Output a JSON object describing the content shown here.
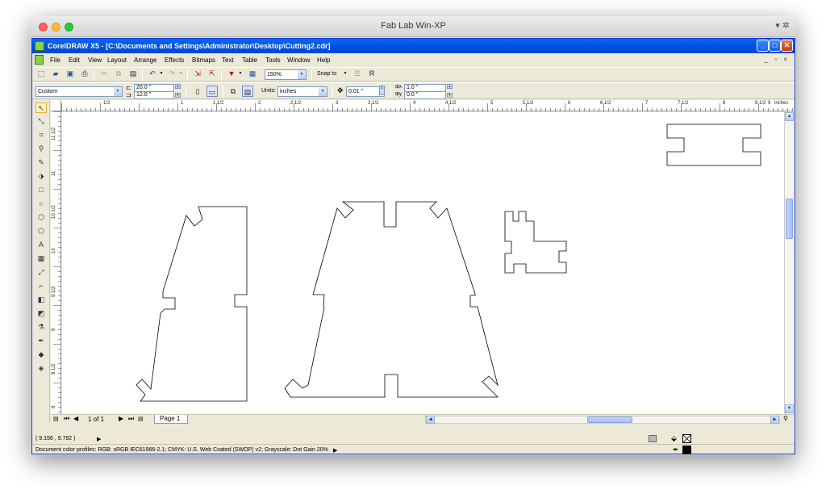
{
  "mac": {
    "title": "Fab Lab Win-XP",
    "title_icons": "▾ ✲"
  },
  "app": {
    "title": "CorelDRAW X5 - [C:\\Documents and Settings\\Administrator\\Desktop\\Cutting2.cdr]",
    "caption_buttons": [
      "_",
      "□",
      "✕"
    ],
    "doc_controls": "_ ▫ ×"
  },
  "menu": [
    "File",
    "Edit",
    "View",
    "Layout",
    "Arrange",
    "Effects",
    "Bitmaps",
    "Text",
    "Table",
    "Tools",
    "Window",
    "Help"
  ],
  "toolbar": {
    "zoom": "150%",
    "snap_label": "Snap to"
  },
  "property_bar": {
    "paper_preset": "Custom",
    "width": "20.0 \"",
    "height": "12.0 \"",
    "units_label": "Units:",
    "units": "inches",
    "nudge": "0.01 \"",
    "dup_x": "1.0 \"",
    "dup_y": "0.0 \""
  },
  "ruler": {
    "h_labels": [
      "1/2",
      "1",
      "1 1/2",
      "2",
      "2 1/2",
      "3",
      "3 1/2",
      "4",
      "4 1/2",
      "5",
      "5 1/2",
      "6",
      "6 1/2",
      "7",
      "7 1/2",
      "8",
      "8 1/2",
      "9"
    ],
    "units": "inches",
    "v_labels": [
      "11 1/2",
      "11",
      "10 1/2",
      "10",
      "9 1/2",
      "9",
      "8 1/2",
      "8"
    ],
    "v_units": "inches"
  },
  "pagebar": {
    "page_count": "1 of 1",
    "page_tab": "Page 1"
  },
  "status": {
    "coords": "( 9.156 , 9.792 )",
    "arrow": "▶",
    "color_profiles": "Document color profiles: RGB: sRGB IEC61966-2.1; CMYK: U.S. Web Coated (SWOP) v2; Grayscale: Dot Gain 20%",
    "profiles_arrow": "▶"
  },
  "colors": {
    "xp_title": "#0055e5",
    "chrome": "#ece9d8",
    "canvas": "#ffffff",
    "shape_stroke": "#000000"
  }
}
